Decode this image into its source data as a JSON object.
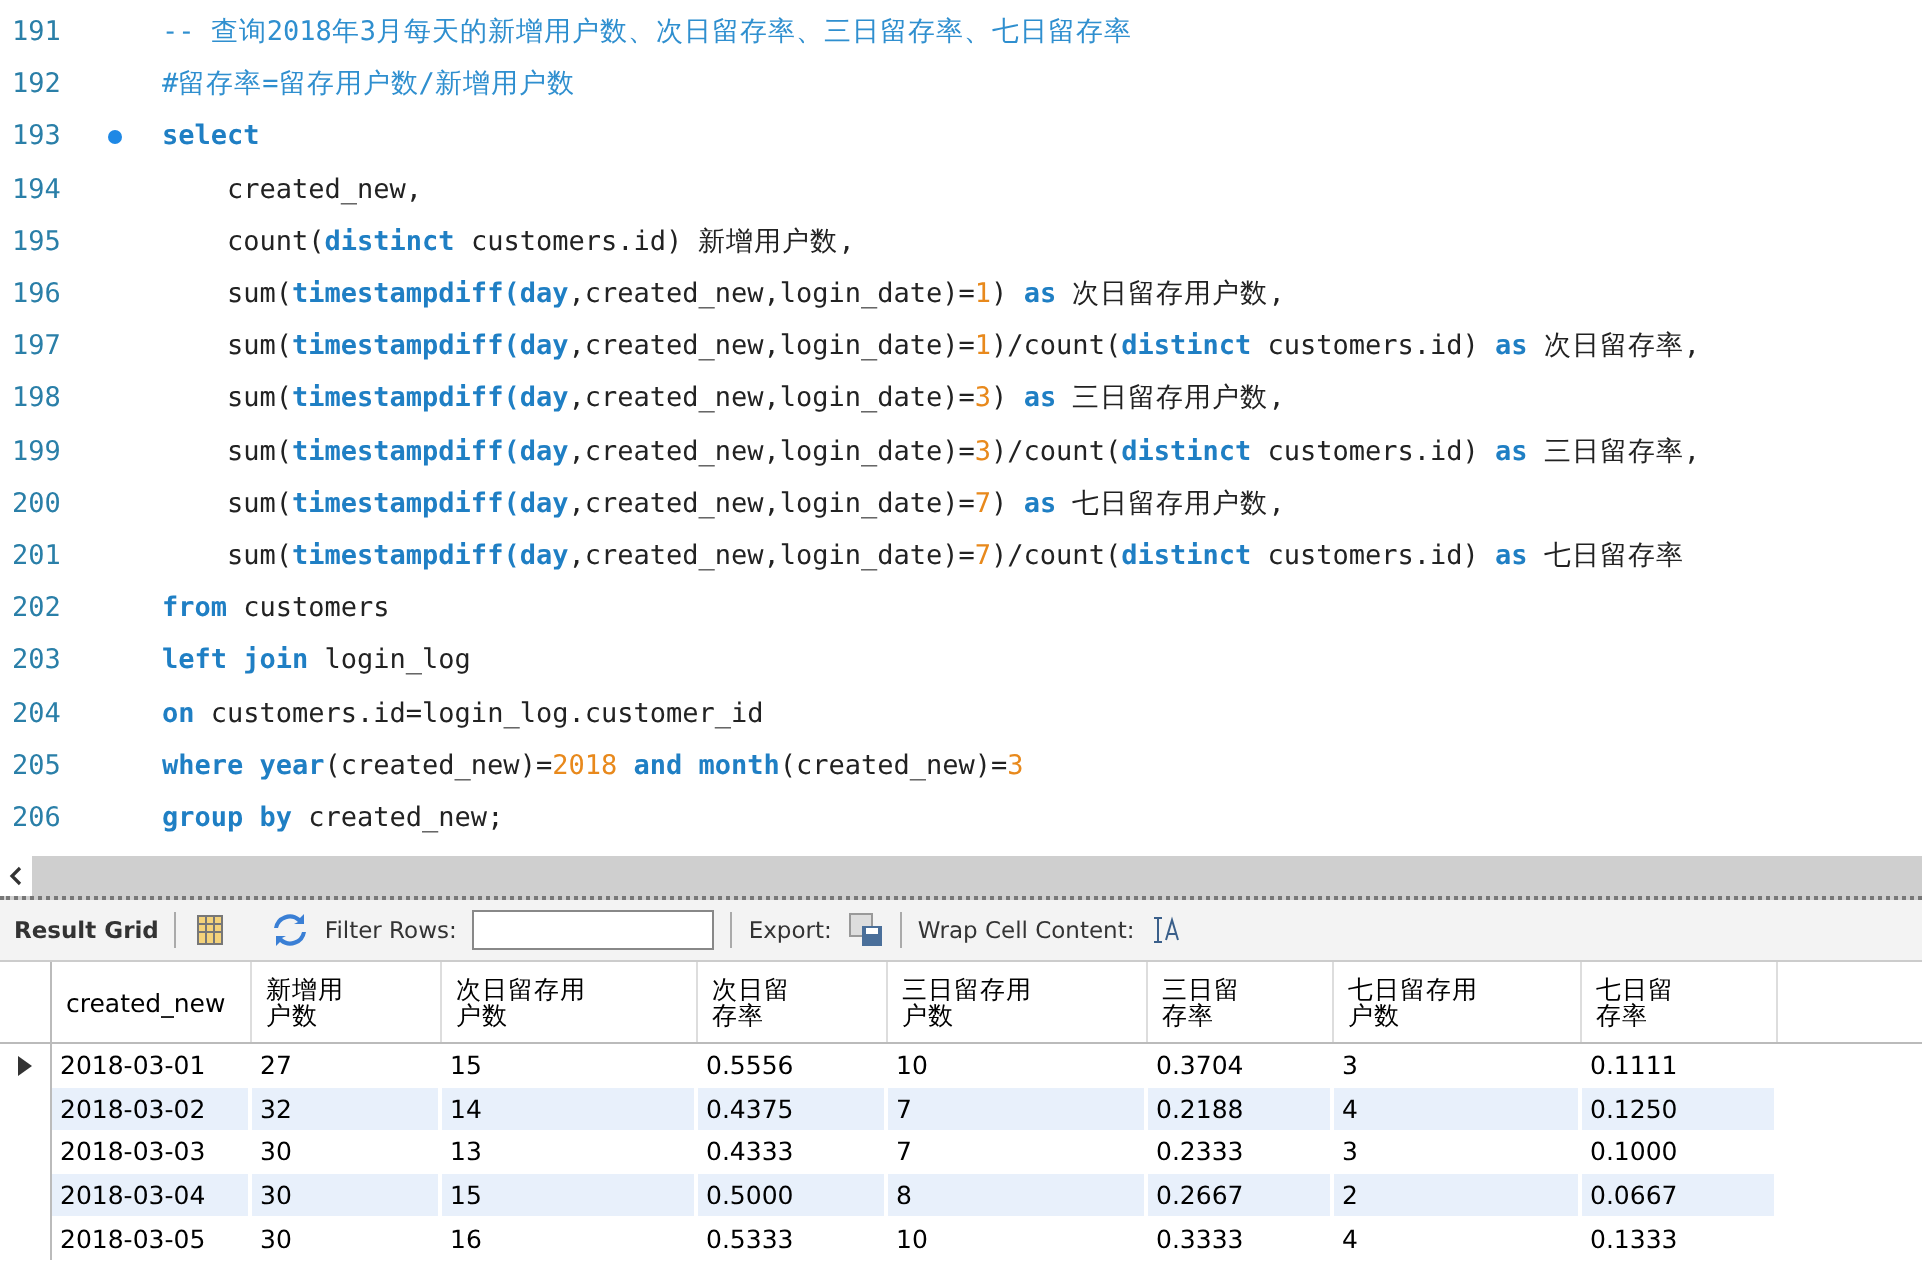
{
  "editor": {
    "lines": [
      {
        "number": "191",
        "breakpoint": false,
        "tokens": [
          {
            "kind": "comment",
            "text": "-- 查询2018年3月每天的新增用户数、次日留存率、三日留存率、七日留存率"
          }
        ]
      },
      {
        "number": "192",
        "breakpoint": false,
        "tokens": [
          {
            "kind": "comment",
            "text": "#留存率=留存用户数/新增用户数"
          }
        ]
      },
      {
        "number": "193",
        "breakpoint": true,
        "tokens": [
          {
            "kind": "keyword",
            "text": "select"
          }
        ]
      },
      {
        "number": "194",
        "breakpoint": false,
        "tokens": [
          {
            "kind": "plain",
            "text": "    created_new,"
          }
        ]
      },
      {
        "number": "195",
        "breakpoint": false,
        "tokens": [
          {
            "kind": "plain",
            "text": "    count("
          },
          {
            "kind": "keyword",
            "text": "distinct"
          },
          {
            "kind": "plain",
            "text": " customers.id) 新增用户数,"
          }
        ]
      },
      {
        "number": "196",
        "breakpoint": false,
        "tokens": [
          {
            "kind": "plain",
            "text": "    sum("
          },
          {
            "kind": "keyword",
            "text": "timestampdiff(day"
          },
          {
            "kind": "plain",
            "text": ",created_new,login_date)="
          },
          {
            "kind": "number",
            "text": "1"
          },
          {
            "kind": "plain",
            "text": ") "
          },
          {
            "kind": "keyword",
            "text": "as"
          },
          {
            "kind": "plain",
            "text": " 次日留存用户数,"
          }
        ]
      },
      {
        "number": "197",
        "breakpoint": false,
        "tokens": [
          {
            "kind": "plain",
            "text": "    sum("
          },
          {
            "kind": "keyword",
            "text": "timestampdiff(day"
          },
          {
            "kind": "plain",
            "text": ",created_new,login_date)="
          },
          {
            "kind": "number",
            "text": "1"
          },
          {
            "kind": "plain",
            "text": ")/count("
          },
          {
            "kind": "keyword",
            "text": "distinct"
          },
          {
            "kind": "plain",
            "text": " customers.id) "
          },
          {
            "kind": "keyword",
            "text": "as"
          },
          {
            "kind": "plain",
            "text": " 次日留存率,"
          }
        ]
      },
      {
        "number": "198",
        "breakpoint": false,
        "tokens": [
          {
            "kind": "plain",
            "text": "    sum("
          },
          {
            "kind": "keyword",
            "text": "timestampdiff(day"
          },
          {
            "kind": "plain",
            "text": ",created_new,login_date)="
          },
          {
            "kind": "number",
            "text": "3"
          },
          {
            "kind": "plain",
            "text": ") "
          },
          {
            "kind": "keyword",
            "text": "as"
          },
          {
            "kind": "plain",
            "text": " 三日留存用户数,"
          }
        ]
      },
      {
        "number": "199",
        "breakpoint": false,
        "tokens": [
          {
            "kind": "plain",
            "text": "    sum("
          },
          {
            "kind": "keyword",
            "text": "timestampdiff(day"
          },
          {
            "kind": "plain",
            "text": ",created_new,login_date)="
          },
          {
            "kind": "number",
            "text": "3"
          },
          {
            "kind": "plain",
            "text": ")/count("
          },
          {
            "kind": "keyword",
            "text": "distinct"
          },
          {
            "kind": "plain",
            "text": " customers.id) "
          },
          {
            "kind": "keyword",
            "text": "as"
          },
          {
            "kind": "plain",
            "text": " 三日留存率,"
          }
        ]
      },
      {
        "number": "200",
        "breakpoint": false,
        "tokens": [
          {
            "kind": "plain",
            "text": "    sum("
          },
          {
            "kind": "keyword",
            "text": "timestampdiff(day"
          },
          {
            "kind": "plain",
            "text": ",created_new,login_date)="
          },
          {
            "kind": "number",
            "text": "7"
          },
          {
            "kind": "plain",
            "text": ") "
          },
          {
            "kind": "keyword",
            "text": "as"
          },
          {
            "kind": "plain",
            "text": " 七日留存用户数,"
          }
        ]
      },
      {
        "number": "201",
        "breakpoint": false,
        "tokens": [
          {
            "kind": "plain",
            "text": "    sum("
          },
          {
            "kind": "keyword",
            "text": "timestampdiff(day"
          },
          {
            "kind": "plain",
            "text": ",created_new,login_date)="
          },
          {
            "kind": "number",
            "text": "7"
          },
          {
            "kind": "plain",
            "text": ")/count("
          },
          {
            "kind": "keyword",
            "text": "distinct"
          },
          {
            "kind": "plain",
            "text": " customers.id) "
          },
          {
            "kind": "keyword",
            "text": "as"
          },
          {
            "kind": "plain",
            "text": " 七日留存率"
          }
        ]
      },
      {
        "number": "202",
        "breakpoint": false,
        "tokens": [
          {
            "kind": "keyword",
            "text": "from"
          },
          {
            "kind": "plain",
            "text": " customers"
          }
        ]
      },
      {
        "number": "203",
        "breakpoint": false,
        "tokens": [
          {
            "kind": "keyword",
            "text": "left join"
          },
          {
            "kind": "plain",
            "text": " login_log"
          }
        ]
      },
      {
        "number": "204",
        "breakpoint": false,
        "tokens": [
          {
            "kind": "keyword",
            "text": "on"
          },
          {
            "kind": "plain",
            "text": " customers.id=login_log.customer_id"
          }
        ]
      },
      {
        "number": "205",
        "breakpoint": false,
        "tokens": [
          {
            "kind": "keyword",
            "text": "where year"
          },
          {
            "kind": "plain",
            "text": "(created_new)="
          },
          {
            "kind": "number",
            "text": "2018"
          },
          {
            "kind": "keyword",
            "text": " and month"
          },
          {
            "kind": "plain",
            "text": "(created_new)="
          },
          {
            "kind": "number",
            "text": "3"
          }
        ]
      },
      {
        "number": "206",
        "breakpoint": false,
        "tokens": [
          {
            "kind": "keyword",
            "text": "group by"
          },
          {
            "kind": "plain",
            "text": " created_new;"
          }
        ]
      }
    ]
  },
  "toolbar": {
    "title": "Result Grid",
    "filter_label": "Filter Rows:",
    "export_label": "Export:",
    "wrap_label": "Wrap Cell Content:"
  },
  "table": {
    "columns": [
      "created_new",
      "新增用户数",
      "次日留存用户数",
      "次日留存率",
      "三日留存用户数",
      "三日留存率",
      "七日留存用户数",
      "七日留存率"
    ],
    "rows": [
      {
        "current": true,
        "cells": [
          "2018-03-01",
          "27",
          "15",
          "0.5556",
          "10",
          "0.3704",
          "3",
          "0.1111"
        ]
      },
      {
        "current": false,
        "cells": [
          "2018-03-02",
          "32",
          "14",
          "0.4375",
          "7",
          "0.2188",
          "4",
          "0.1250"
        ]
      },
      {
        "current": false,
        "cells": [
          "2018-03-03",
          "30",
          "13",
          "0.4333",
          "7",
          "0.2333",
          "3",
          "0.1000"
        ]
      },
      {
        "current": false,
        "cells": [
          "2018-03-04",
          "30",
          "15",
          "0.5000",
          "8",
          "0.2667",
          "2",
          "0.0667"
        ]
      },
      {
        "current": false,
        "cells": [
          "2018-03-05",
          "30",
          "16",
          "0.5333",
          "10",
          "0.3333",
          "4",
          "0.1333"
        ]
      }
    ]
  }
}
